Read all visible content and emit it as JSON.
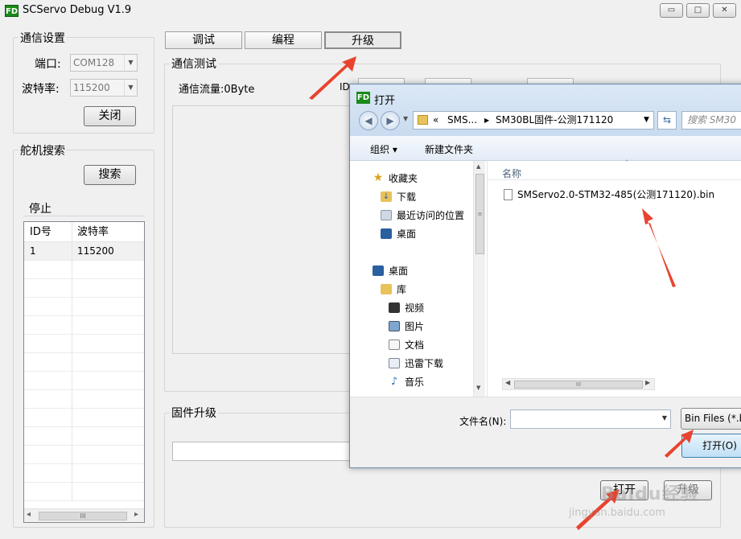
{
  "window": {
    "title": "SCServo Debug V1.9",
    "icon_text": "FD",
    "min_glyph": "▭",
    "max_glyph": "□",
    "close_glyph": "✕"
  },
  "comm": {
    "group_title": "通信设置",
    "port_label": "端口:",
    "port_value": "COM128",
    "baud_label": "波特率:",
    "baud_value": "115200",
    "close_button": "关闭"
  },
  "servo": {
    "group_title": "舵机搜索",
    "search_button": "搜索",
    "status": "停止",
    "columns": [
      "ID号",
      "波特率"
    ],
    "rows": [
      [
        "1",
        "115200"
      ]
    ],
    "scroll_left": "◂",
    "scroll_thumb": "III",
    "scroll_right": "▸"
  },
  "tabs": [
    "调试",
    "编程",
    "升级"
  ],
  "test": {
    "group_title": "通信测试",
    "traffic": "通信流量:0Byte",
    "id_label": "ID"
  },
  "firmware": {
    "group_title": "固件升级",
    "open_button": "打开",
    "upgrade_button": "升级"
  },
  "dialog": {
    "title": "打开",
    "breadcrumb": [
      "«",
      "SMS...",
      "SM30BL固件-公测171120"
    ],
    "search_placeholder": "搜索 SM30",
    "organize": "组织 ▾",
    "new_folder": "新建文件夹",
    "nav": {
      "favorites": "收藏夹",
      "downloads": "下载",
      "recent": "最近访问的位置",
      "desktop_fav": "桌面",
      "desktop": "桌面",
      "library": "库",
      "videos": "视频",
      "pictures": "图片",
      "documents": "文档",
      "xunlei": "迅雷下载",
      "music": "音乐"
    },
    "column_name": "名称",
    "file_name": "SMServo2.0-STM32-485(公测171120).bin",
    "filename_label": "文件名(N):",
    "filename_value": "",
    "filter": "Bin Files (*.b",
    "open_button": "打开(O)"
  },
  "watermark": {
    "brand": "Baidu经验",
    "url": "jingyan.baidu.com"
  },
  "colors": {
    "accent": "#e8432f",
    "dialog_chrome": "#c9dbef",
    "selection": "#3c7fb1"
  }
}
